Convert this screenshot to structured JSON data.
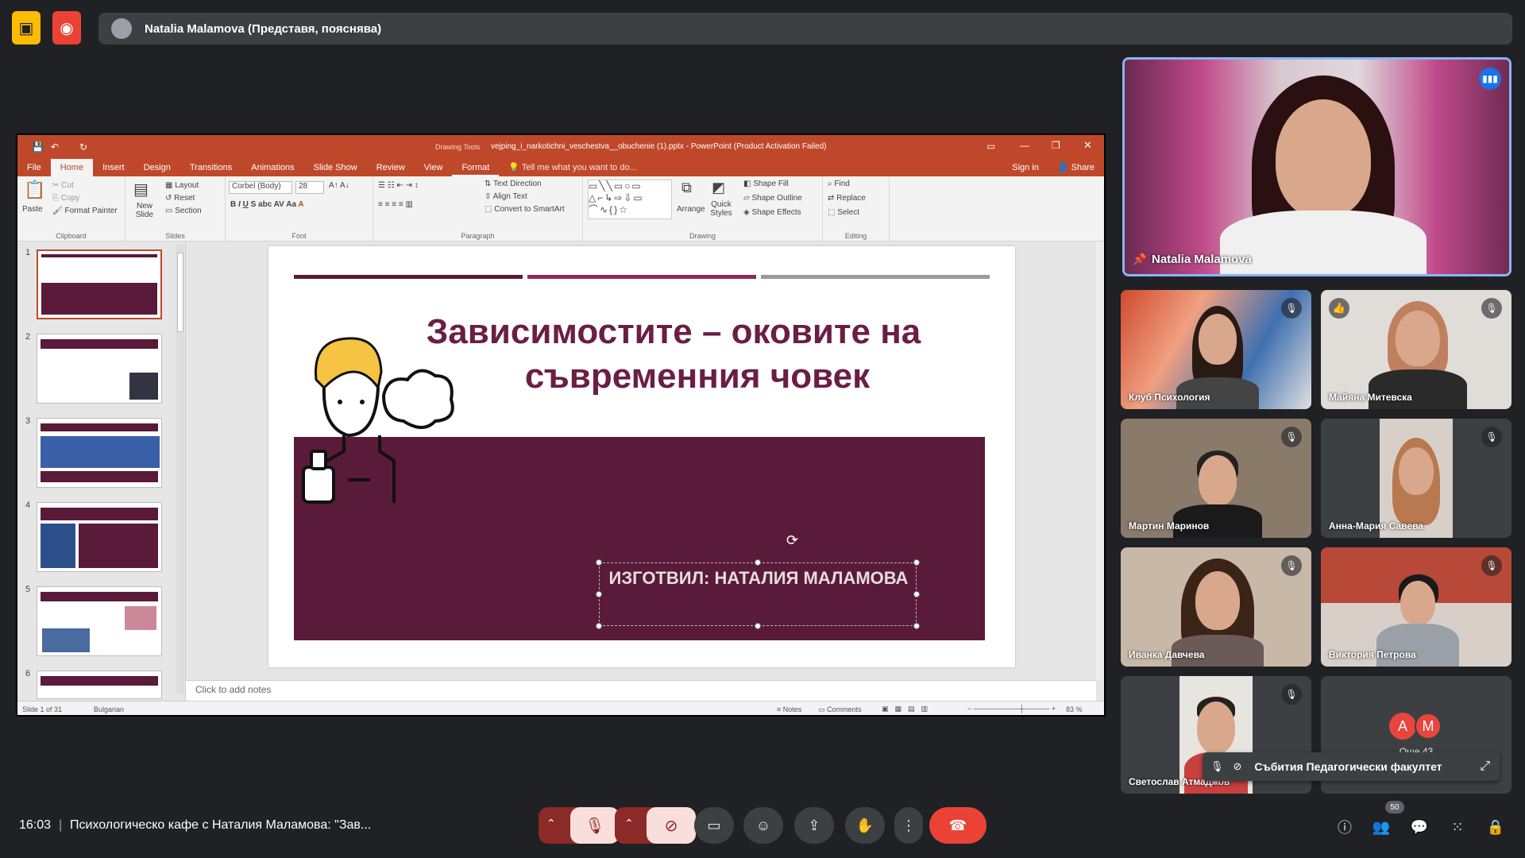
{
  "meet": {
    "presenting_text": "Natalia Malamova (Представя, пояснява)",
    "time": "16:03",
    "meeting_title": "Психологическо кафе с Наталия Маламова: \"Зав...",
    "participant_count": "50"
  },
  "ppt": {
    "drawing_tools": "Drawing Tools",
    "window_title": "vejping_i_narkotichni_veschestva__obuchenie (1).pptx - PowerPoint (Product Activation Failed)",
    "tabs": [
      "File",
      "Home",
      "Insert",
      "Design",
      "Transitions",
      "Animations",
      "Slide Show",
      "Review",
      "View",
      "Format"
    ],
    "tell_me": "Tell me what you want to do...",
    "sign_in": "Sign in",
    "share": "Share",
    "ribbon": {
      "paste": "Paste",
      "cut": "Cut",
      "copy": "Copy",
      "format_painter": "Format Painter",
      "clipboard": "Clipboard",
      "new_slide": "New Slide",
      "layout": "Layout",
      "reset": "Reset",
      "section": "Section",
      "slides": "Slides",
      "font_name": "Corbel (Body)",
      "font_size": "28",
      "font": "Font",
      "text_direction": "Text Direction",
      "align_text": "Align Text",
      "convert_smartart": "Convert to SmartArt",
      "paragraph": "Paragraph",
      "arrange": "Arrange",
      "quick_styles": "Quick Styles",
      "shape_fill": "Shape Fill",
      "shape_outline": "Shape Outline",
      "shape_effects": "Shape Effects",
      "drawing": "Drawing",
      "find": "Find",
      "replace": "Replace",
      "select": "Select",
      "editing": "Editing"
    },
    "thumb_numbers": [
      "1",
      "2",
      "3",
      "4",
      "5",
      "6"
    ],
    "slide": {
      "title_line1": "Зависимостите – оковите на",
      "title_line2": "съвременния човек",
      "author": "ИЗГОТВИЛ: НАТАЛИЯ МАЛАМОВА"
    },
    "notes_placeholder": "Click to add notes",
    "status": {
      "slide_info": "Slide 1 of 31",
      "language": "Bulgarian",
      "notes": "Notes",
      "comments": "Comments",
      "zoom": "83 %"
    }
  },
  "participants": [
    {
      "name": "Natalia Malamova"
    },
    {
      "name": "Клуб Психология"
    },
    {
      "name": "Майяна Митевска"
    },
    {
      "name": "Мартин Маринов"
    },
    {
      "name": "Анна-Мария Савева"
    },
    {
      "name": "Иванка Давчева"
    },
    {
      "name": "Виктория Петрова"
    },
    {
      "name": "Светослав Атмаджов"
    }
  ],
  "overflow_tile": {
    "avatar1": "A",
    "avatar2": "M",
    "others": "Още 43",
    "caption": "Събития Педагогически факултет"
  },
  "colors": {
    "ppt_accent": "#c0482a",
    "slide_maroon": "#5a1a3a",
    "hangup": "#ea4335",
    "muted_red": "#f28b82"
  }
}
